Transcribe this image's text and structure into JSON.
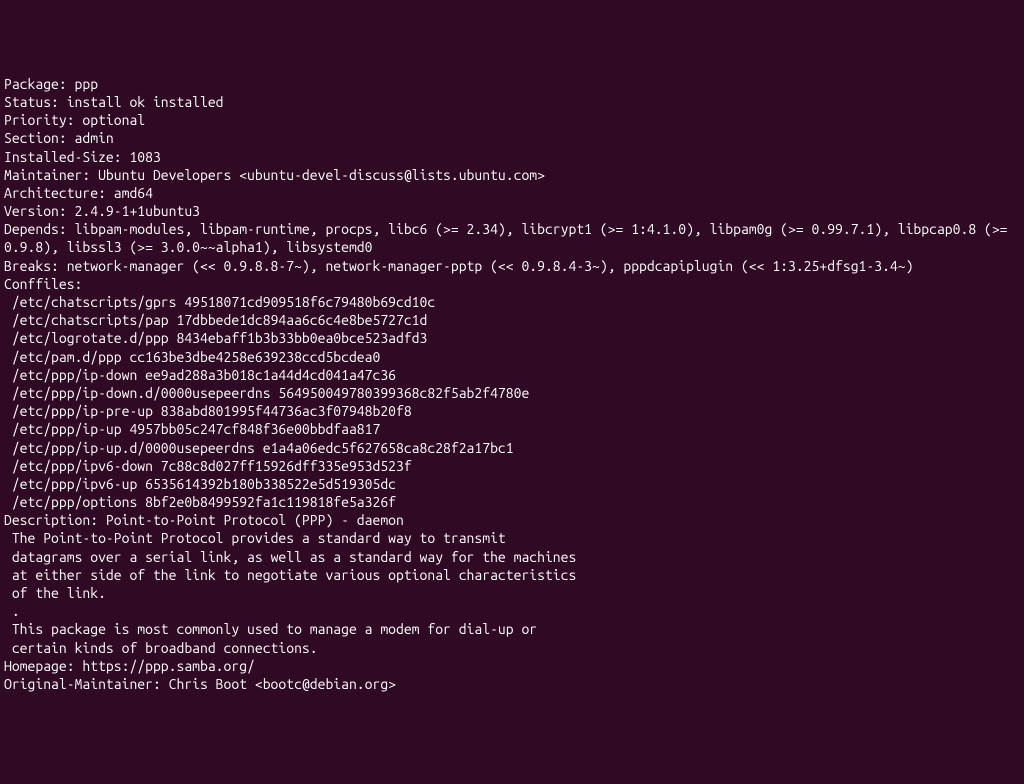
{
  "lines": [
    "Package: ppp",
    "Status: install ok installed",
    "Priority: optional",
    "Section: admin",
    "Installed-Size: 1083",
    "Maintainer: Ubuntu Developers <ubuntu-devel-discuss@lists.ubuntu.com>",
    "Architecture: amd64",
    "Version: 2.4.9-1+1ubuntu3",
    "Depends: libpam-modules, libpam-runtime, procps, libc6 (>= 2.34), libcrypt1 (>= 1:4.1.0), libpam0g (>= 0.99.7.1), libpcap0.8 (>= 0.9.8), libssl3 (>= 3.0.0~~alpha1), libsystemd0",
    "Breaks: network-manager (<< 0.9.8.8-7~), network-manager-pptp (<< 0.9.8.4-3~), pppdcapiplugin (<< 1:3.25+dfsg1-3.4~)",
    "Conffiles:",
    " /etc/chatscripts/gprs 49518071cd909518f6c79480b69cd10c",
    " /etc/chatscripts/pap 17dbbede1dc894aa6c6c4e8be5727c1d",
    " /etc/logrotate.d/ppp 8434ebaff1b3b33bb0ea0bce523adfd3",
    " /etc/pam.d/ppp cc163be3dbe4258e639238ccd5bcdea0",
    " /etc/ppp/ip-down ee9ad288a3b018c1a44d4cd041a47c36",
    " /etc/ppp/ip-down.d/0000usepeerdns 564950049780399368c82f5ab2f4780e",
    " /etc/ppp/ip-pre-up 838abd801995f44736ac3f07948b20f8",
    " /etc/ppp/ip-up 4957bb05c247cf848f36e00bbdfaa817",
    " /etc/ppp/ip-up.d/0000usepeerdns e1a4a06edc5f627658ca8c28f2a17bc1",
    " /etc/ppp/ipv6-down 7c88c8d027ff15926dff335e953d523f",
    " /etc/ppp/ipv6-up 6535614392b180b338522e5d519305dc",
    " /etc/ppp/options 8bf2e0b8499592fa1c119818fe5a326f",
    "Description: Point-to-Point Protocol (PPP) - daemon",
    " The Point-to-Point Protocol provides a standard way to transmit",
    " datagrams over a serial link, as well as a standard way for the machines",
    " at either side of the link to negotiate various optional characteristics",
    " of the link.",
    " .",
    " This package is most commonly used to manage a modem for dial-up or",
    " certain kinds of broadband connections.",
    "Homepage: https://ppp.samba.org/",
    "Original-Maintainer: Chris Boot <bootc@debian.org>"
  ]
}
